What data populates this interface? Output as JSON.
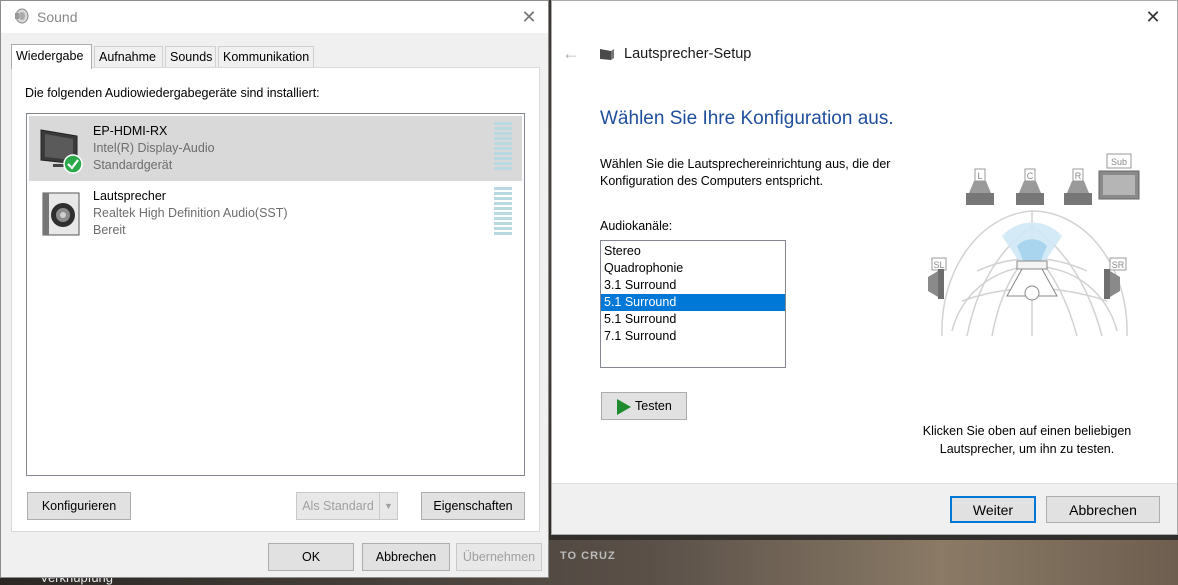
{
  "desktop": {
    "taskbar_text": "Verknüpfung",
    "logo_text": "TO CRUZ"
  },
  "sound": {
    "title": "Sound",
    "close_glyph": "✕",
    "tabs": [
      {
        "label": "Wiedergabe",
        "active": true
      },
      {
        "label": "Aufnahme",
        "active": false
      },
      {
        "label": "Sounds",
        "active": false
      },
      {
        "label": "Kommunikation",
        "active": false
      }
    ],
    "caption": "Die folgenden Audiowiedergabegeräte sind installiert:",
    "devices": [
      {
        "name": "EP-HDMI-RX",
        "driver": "Intel(R) Display-Audio",
        "status": "Standardgerät",
        "icon": "monitor-icon",
        "selected": true
      },
      {
        "name": "Lautsprecher",
        "driver": "Realtek High Definition Audio(SST)",
        "status": "Bereit",
        "icon": "speaker-icon",
        "selected": false
      }
    ],
    "buttons": {
      "configure": "Konfigurieren",
      "set_default": "Als Standard",
      "properties": "Eigenschaften",
      "ok": "OK",
      "cancel": "Abbrechen",
      "apply": "Übernehmen"
    }
  },
  "setup": {
    "window_title": "Lautsprecher-Setup",
    "heading": "Wählen Sie Ihre Konfiguration aus.",
    "description": "Wählen Sie die Lautsprechereinrichtung aus, die der Konfiguration des Computers entspricht.",
    "channels_label": "Audiokanäle:",
    "channels": [
      {
        "label": "Stereo",
        "selected": false
      },
      {
        "label": "Quadrophonie",
        "selected": false
      },
      {
        "label": "3.1 Surround",
        "selected": false
      },
      {
        "label": "5.1 Surround",
        "selected": true
      },
      {
        "label": "5.1 Surround",
        "selected": false
      },
      {
        "label": "7.1 Surround",
        "selected": false
      }
    ],
    "test_button": "Testen",
    "speaker_labels": {
      "left": "L",
      "center": "C",
      "right": "R",
      "sub": "Sub",
      "side_left": "SL",
      "side_right": "SR"
    },
    "hint": "Klicken Sie oben auf einen beliebigen Lautsprecher, um ihn zu testen.",
    "next_button": "Weiter",
    "cancel_button": "Abbrechen",
    "accent_color": "#1f4e9c",
    "selection_color": "#0078d7"
  }
}
